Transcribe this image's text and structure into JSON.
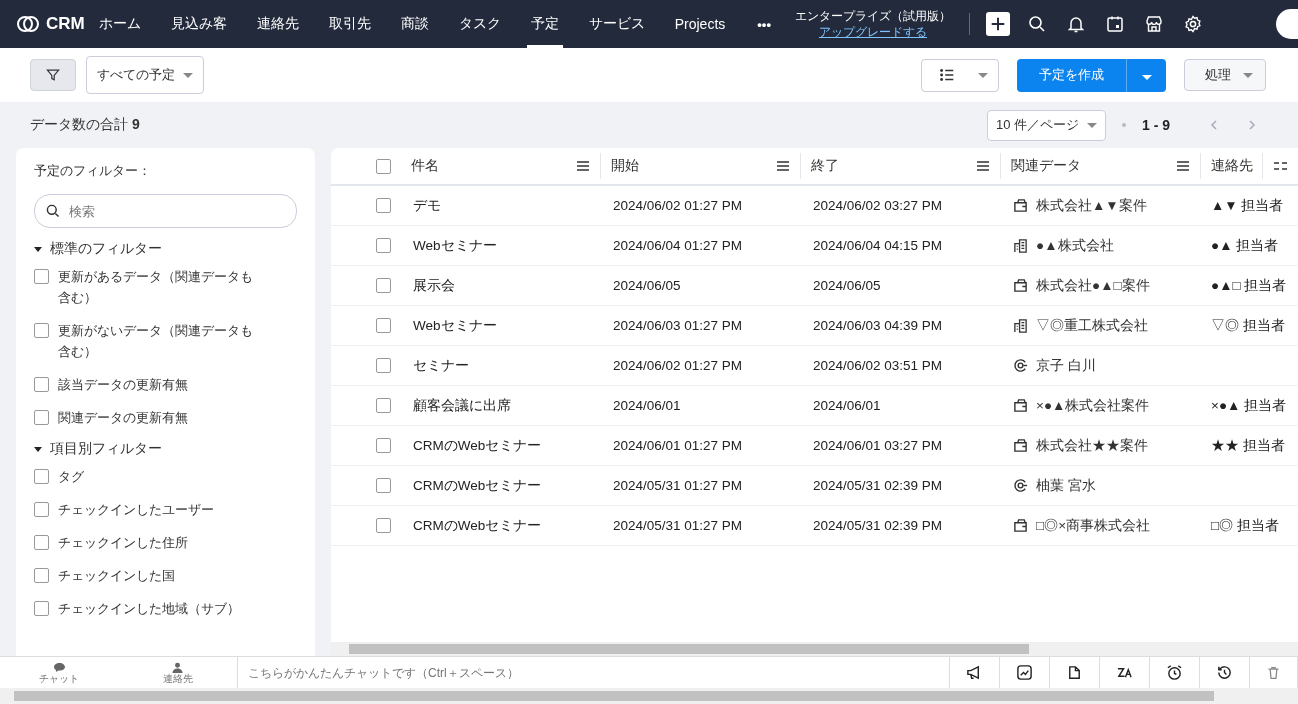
{
  "nav": {
    "logo": "CRM",
    "tabs": [
      {
        "label": "ホーム",
        "selected": false
      },
      {
        "label": "見込み客",
        "selected": false
      },
      {
        "label": "連絡先",
        "selected": false
      },
      {
        "label": "取引先",
        "selected": false
      },
      {
        "label": "商談",
        "selected": false
      },
      {
        "label": "タスク",
        "selected": false
      },
      {
        "label": "予定",
        "selected": true
      },
      {
        "label": "サービス",
        "selected": false
      },
      {
        "label": "Projects",
        "selected": false
      }
    ],
    "more": "•••",
    "plan": "エンタープライズ（試用版）",
    "upgrade": "アップグレードする"
  },
  "toolbar": {
    "view": "すべての予定",
    "create": "予定を作成",
    "action": "処理"
  },
  "summary": {
    "count": "データ数の合計 **9**",
    "per_page": "10 件／ページ",
    "range": "1 - 9"
  },
  "sidebar": {
    "title": "予定のフィルター：",
    "search_placeholder": "検索",
    "sections": [
      {
        "title": "標準のフィルター",
        "expanded": true,
        "items": [
          {
            "label": "更新があるデータ（関連データも含む）",
            "checked": false
          },
          {
            "label": "更新がないデータ（関連データも含む）",
            "checked": false
          },
          {
            "label": "該当データの更新有無",
            "checked": false
          },
          {
            "label": "関連データの更新有無",
            "checked": false
          }
        ]
      },
      {
        "title": "項目別フィルター",
        "expanded": true,
        "items": [
          {
            "label": "タグ",
            "checked": false
          },
          {
            "label": "チェックインしたユーザー",
            "checked": false
          },
          {
            "label": "チェックインした住所",
            "checked": false
          },
          {
            "label": "チェックインした国",
            "checked": false
          },
          {
            "label": "チェックインした地域（サブ）",
            "checked": false
          }
        ]
      }
    ]
  },
  "table": {
    "all_checked": false,
    "columns": [
      "件名",
      "開始",
      "終了",
      "関連データ",
      "連絡先"
    ],
    "rows": [
      {
        "checked": false,
        "subject": "デモ",
        "start": "2024/06/02 01:27 PM",
        "end": "2024/06/02 03:27 PM",
        "related": {
          "kind": "deal",
          "text": "株式会社▲▼案件"
        },
        "contact": "▲▼ 担当者"
      },
      {
        "checked": false,
        "subject": "Webセミナー",
        "start": "2024/06/04 01:27 PM",
        "end": "2024/06/04 04:15 PM",
        "related": {
          "kind": "account",
          "text": "●▲株式会社"
        },
        "contact": "●▲ 担当者"
      },
      {
        "checked": false,
        "subject": "展示会",
        "start": "2024/06/05",
        "end": "2024/06/05",
        "related": {
          "kind": "deal",
          "text": "株式会社●▲□案件"
        },
        "contact": "●▲□ 担当者"
      },
      {
        "checked": false,
        "subject": "Webセミナー",
        "start": "2024/06/03 01:27 PM",
        "end": "2024/06/03 04:39 PM",
        "related": {
          "kind": "account",
          "text": "▽◎重工株式会社"
        },
        "contact": "▽◎ 担当者"
      },
      {
        "checked": false,
        "subject": "セミナー",
        "start": "2024/06/02 01:27 PM",
        "end": "2024/06/02 03:51 PM",
        "related": {
          "kind": "contact",
          "text": "京子 白川"
        }
      },
      {
        "checked": false,
        "subject": "顧客会議に出席",
        "start": "2024/06/01",
        "end": "2024/06/01",
        "related": {
          "kind": "deal",
          "text": "×●▲株式会社案件"
        },
        "contact": "×●▲ 担当者"
      },
      {
        "checked": false,
        "subject": "CRMのWebセミナー",
        "start": "2024/06/01 01:27 PM",
        "end": "2024/06/01 03:27 PM",
        "related": {
          "kind": "deal",
          "text": "株式会社★★案件"
        },
        "contact": "★★ 担当者"
      },
      {
        "checked": false,
        "subject": "CRMのWebセミナー",
        "start": "2024/05/31 01:27 PM",
        "end": "2024/05/31 02:39 PM",
        "related": {
          "kind": "contact",
          "text": "柚葉 宮水"
        }
      },
      {
        "checked": false,
        "subject": "CRMのWebセミナー",
        "start": "2024/05/31 01:27 PM",
        "end": "2024/05/31 02:39 PM",
        "related": {
          "kind": "deal",
          "text": "□◎×商事株式会社"
        },
        "contact": "□◎ 担当者"
      }
    ]
  },
  "footer": {
    "tabs": [
      "チャット",
      "連絡先"
    ],
    "chat_placeholder": "こちらがかんたんチャットです（Ctrl＋スペース）"
  }
}
